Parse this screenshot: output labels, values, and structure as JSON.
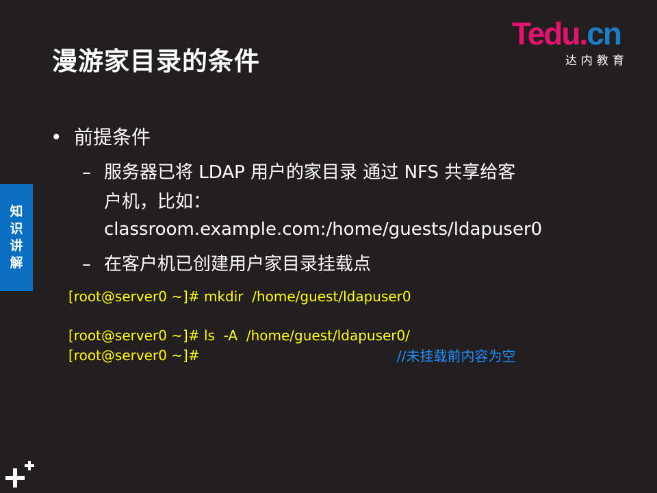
{
  "slide": {
    "title": "漫游家目录的条件",
    "logo": {
      "word_t": "T",
      "word_rest": "edu.",
      "word_cn": "cn",
      "subtitle": "达内教育"
    },
    "side_tab": "知识讲解",
    "bullet": {
      "symbol": "•",
      "text": "前提条件"
    },
    "sub_items": [
      {
        "dash": "–",
        "line1": "服务器已将 LDAP 用户的家目录 通过 NFS 共享给客",
        "line2": "户机，比如：",
        "line3": "classroom.example.com:/home/guests/ldapuser0"
      },
      {
        "dash": "–",
        "line1": "在客户机已创建用户家目录挂载点"
      }
    ],
    "code_lines": [
      "[root@server0 ~]# mkdir  /home/guest/ldapuser0",
      "[root@server0 ~]# ls  -A  /home/guest/ldapuser0/",
      "[root@server0 ~]#"
    ],
    "comment": "//未挂载前内容为空",
    "colors": {
      "background": "#231f20",
      "code": "#ffff00",
      "comment": "#1e90ff",
      "side_tab": "#0a6fc2",
      "logo_pink": "#e4136f",
      "logo_blue": "#1c7ec6"
    },
    "corner_icon": "plus-plus-icon"
  }
}
